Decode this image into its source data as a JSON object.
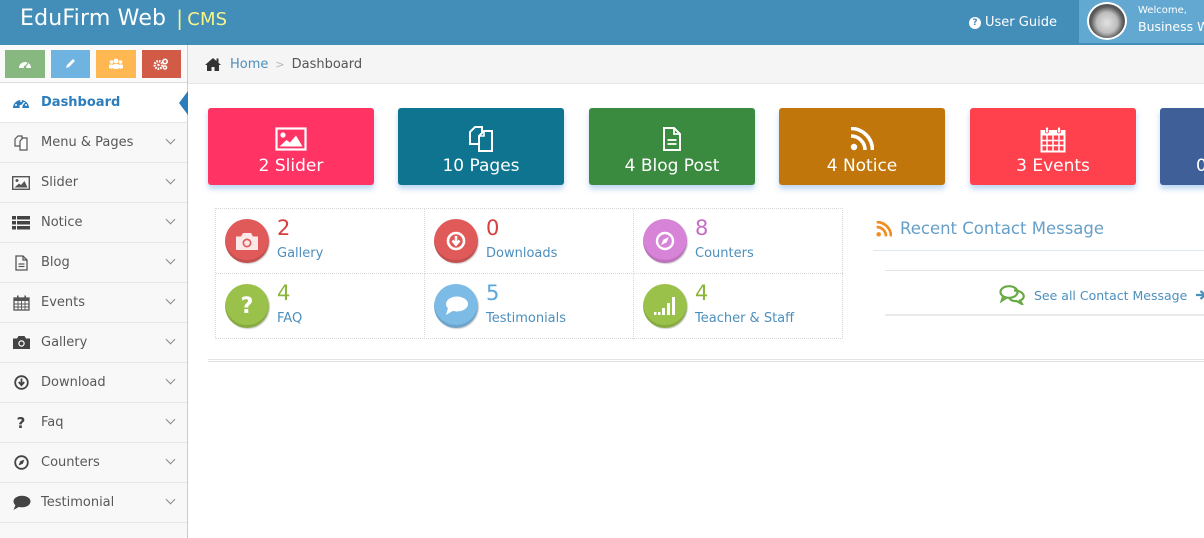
{
  "header": {
    "brand": "EduFirm Web",
    "brand_sep": "|",
    "brand_sub": "CMS",
    "user_guide": "User Guide",
    "welcome": "Welcome,",
    "user_name": "Business W"
  },
  "shortcuts": [
    {
      "icon": "dashboard-icon",
      "color": "#87b87f"
    },
    {
      "icon": "pencil-icon",
      "color": "#6fb3e0"
    },
    {
      "icon": "users-icon",
      "color": "#ffb752"
    },
    {
      "icon": "cogs-icon",
      "color": "#d15b47"
    }
  ],
  "sidebar": {
    "items": [
      {
        "label": "Dashboard",
        "icon": "dashboard-icon",
        "active": true
      },
      {
        "label": "Menu & Pages",
        "icon": "copy-icon"
      },
      {
        "label": "Slider",
        "icon": "picture-icon"
      },
      {
        "label": "Notice",
        "icon": "list-icon"
      },
      {
        "label": "Blog",
        "icon": "file-text-icon"
      },
      {
        "label": "Events",
        "icon": "calendar-icon"
      },
      {
        "label": "Gallery",
        "icon": "camera-icon"
      },
      {
        "label": "Download",
        "icon": "download-icon"
      },
      {
        "label": "Faq",
        "icon": "question-icon"
      },
      {
        "label": "Counters",
        "icon": "compass-icon"
      },
      {
        "label": "Testimonial",
        "icon": "comment-icon"
      }
    ]
  },
  "breadcrumb": {
    "home": "Home",
    "current": "Dashboard"
  },
  "stats": [
    {
      "label": "2 Slider",
      "icon": "picture-icon",
      "color": "#ff3465"
    },
    {
      "label": "10 Pages",
      "icon": "copy-icon",
      "color": "#0e7490"
    },
    {
      "label": "4 Blog Post",
      "icon": "file-text-icon",
      "color": "#3a8a40"
    },
    {
      "label": "4 Notice",
      "icon": "rss-icon",
      "color": "#c0760a"
    },
    {
      "label": "3 Events",
      "icon": "calendar-icon",
      "color": "#ff414e"
    },
    {
      "label": "0",
      "icon": "",
      "color": "#3f5f98"
    }
  ],
  "infoboxes": [
    {
      "value": "2",
      "label": "Gallery",
      "icon": "camera-icon",
      "color": "#d53f40",
      "circle": "#e05a5a"
    },
    {
      "value": "0",
      "label": "Downloads",
      "icon": "download-icon",
      "color": "#d53f40",
      "circle": "#e05a5a"
    },
    {
      "value": "8",
      "label": "Counters",
      "icon": "compass-icon",
      "color": "#c36ec3",
      "circle": "#d783d7"
    },
    {
      "value": "4",
      "label": "FAQ",
      "icon": "question-icon",
      "color": "#8ab43a",
      "circle": "#9ac24b"
    },
    {
      "value": "5",
      "label": "Testimonials",
      "icon": "comment-icon",
      "color": "#5aa7dc",
      "circle": "#7cbbe6"
    },
    {
      "value": "4",
      "label": "Teacher & Staff",
      "icon": "signal-icon",
      "color": "#8ab43a",
      "circle": "#9ac24b"
    }
  ],
  "contact_widget": {
    "title": "Recent Contact Message",
    "see_all": "See all Contact Message"
  }
}
